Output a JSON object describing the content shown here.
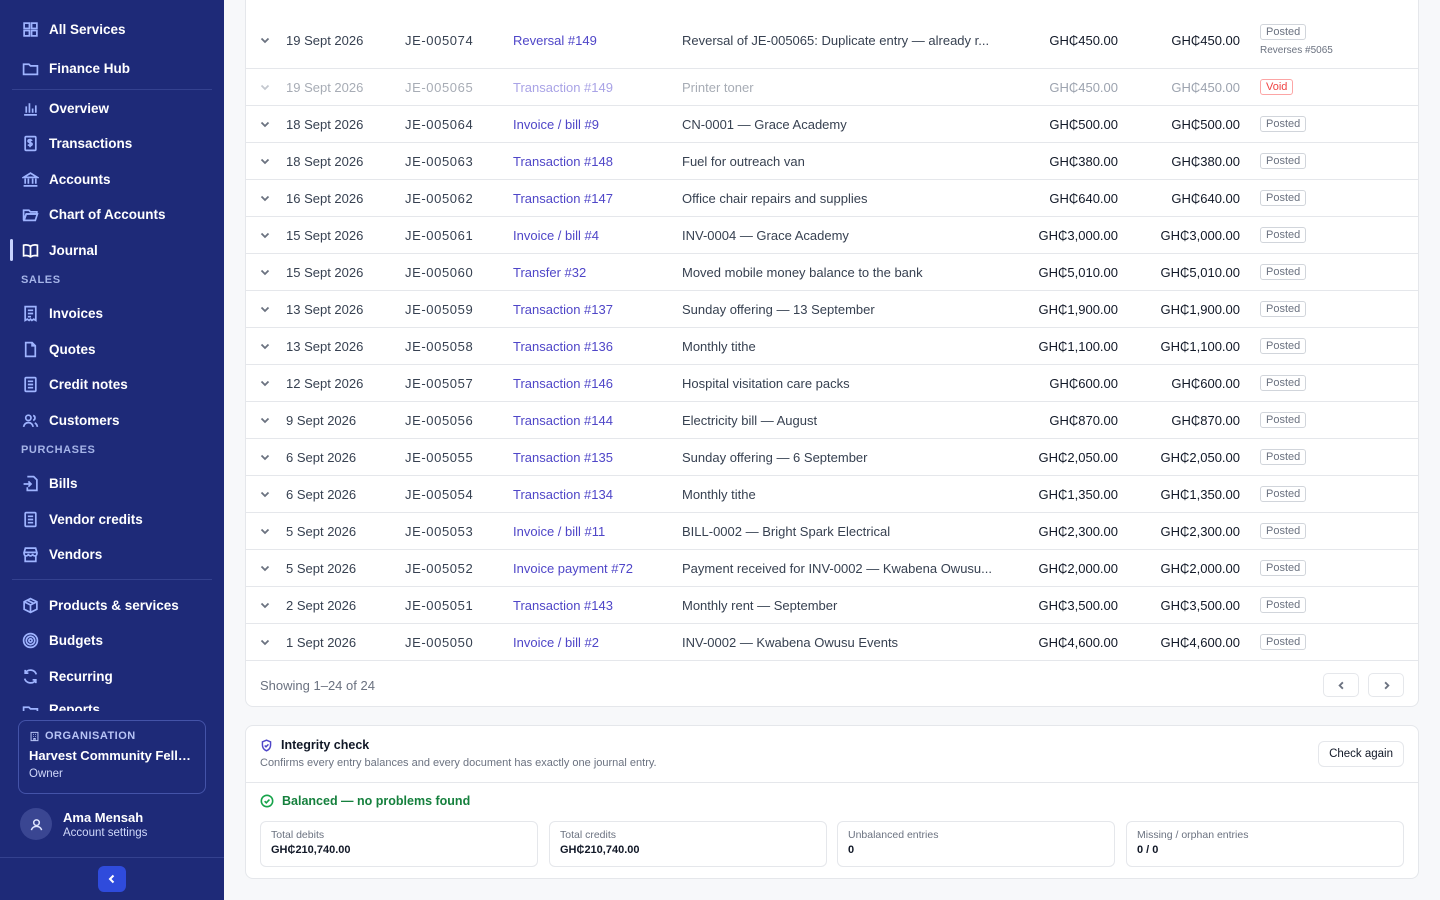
{
  "sidebar": {
    "top_items": [
      {
        "label": "All Services",
        "icon": "grid-icon"
      },
      {
        "label": "Finance Hub",
        "icon": "folder-icon"
      }
    ],
    "main_items": [
      {
        "label": "Overview",
        "icon": "bar-chart-icon"
      },
      {
        "label": "Transactions",
        "icon": "dollar-doc-icon"
      },
      {
        "label": "Accounts",
        "icon": "bank-icon"
      },
      {
        "label": "Chart of Accounts",
        "icon": "folder-open-icon"
      },
      {
        "label": "Journal",
        "icon": "book-open-icon",
        "active": true
      }
    ],
    "sales_label": "SALES",
    "sales_items": [
      {
        "label": "Invoices",
        "icon": "receipt-icon"
      },
      {
        "label": "Quotes",
        "icon": "document-icon"
      },
      {
        "label": "Credit notes",
        "icon": "document-lines-icon"
      },
      {
        "label": "Customers",
        "icon": "users-icon"
      }
    ],
    "purchases_label": "PURCHASES",
    "purchases_items": [
      {
        "label": "Bills",
        "icon": "file-import-icon"
      },
      {
        "label": "Vendor credits",
        "icon": "document-lines-icon"
      },
      {
        "label": "Vendors",
        "icon": "store-icon"
      }
    ],
    "other_items": [
      {
        "label": "Products & services",
        "icon": "package-icon"
      },
      {
        "label": "Budgets",
        "icon": "target-icon"
      },
      {
        "label": "Recurring",
        "icon": "refresh-icon"
      },
      {
        "label": "Reports",
        "icon": "folder-icon"
      }
    ],
    "org": {
      "label": "ORGANISATION",
      "name": "Harvest Community Fello...",
      "role": "Owner"
    },
    "user": {
      "name": "Ama Mensah",
      "sub": "Account settings"
    }
  },
  "journal": {
    "rows": [
      {
        "date": "19 Sept 2026",
        "id": "JE-005074",
        "source": "Reversal #149",
        "description": "Reversal of JE-005065: Duplicate entry — already r...",
        "debit": "GH₵450.00",
        "credit": "GH₵450.00",
        "status": "Posted",
        "note": "Reverses #5065"
      },
      {
        "date": "19 Sept 2026",
        "id": "JE-005065",
        "source": "Transaction #149",
        "description": "Printer toner",
        "debit": "GH₵450.00",
        "credit": "GH₵450.00",
        "status": "Void",
        "muted": true
      },
      {
        "date": "18 Sept 2026",
        "id": "JE-005064",
        "source": "Invoice / bill #9",
        "description": "CN-0001 — Grace Academy",
        "debit": "GH₵500.00",
        "credit": "GH₵500.00",
        "status": "Posted"
      },
      {
        "date": "18 Sept 2026",
        "id": "JE-005063",
        "source": "Transaction #148",
        "description": "Fuel for outreach van",
        "debit": "GH₵380.00",
        "credit": "GH₵380.00",
        "status": "Posted"
      },
      {
        "date": "16 Sept 2026",
        "id": "JE-005062",
        "source": "Transaction #147",
        "description": "Office chair repairs and supplies",
        "debit": "GH₵640.00",
        "credit": "GH₵640.00",
        "status": "Posted"
      },
      {
        "date": "15 Sept 2026",
        "id": "JE-005061",
        "source": "Invoice / bill #4",
        "description": "INV-0004 — Grace Academy",
        "debit": "GH₵3,000.00",
        "credit": "GH₵3,000.00",
        "status": "Posted"
      },
      {
        "date": "15 Sept 2026",
        "id": "JE-005060",
        "source": "Transfer #32",
        "description": "Moved mobile money balance to the bank",
        "debit": "GH₵5,010.00",
        "credit": "GH₵5,010.00",
        "status": "Posted"
      },
      {
        "date": "13 Sept 2026",
        "id": "JE-005059",
        "source": "Transaction #137",
        "description": "Sunday offering — 13 September",
        "debit": "GH₵1,900.00",
        "credit": "GH₵1,900.00",
        "status": "Posted"
      },
      {
        "date": "13 Sept 2026",
        "id": "JE-005058",
        "source": "Transaction #136",
        "description": "Monthly tithe",
        "debit": "GH₵1,100.00",
        "credit": "GH₵1,100.00",
        "status": "Posted"
      },
      {
        "date": "12 Sept 2026",
        "id": "JE-005057",
        "source": "Transaction #146",
        "description": "Hospital visitation care packs",
        "debit": "GH₵600.00",
        "credit": "GH₵600.00",
        "status": "Posted"
      },
      {
        "date": "9 Sept 2026",
        "id": "JE-005056",
        "source": "Transaction #144",
        "description": "Electricity bill — August",
        "debit": "GH₵870.00",
        "credit": "GH₵870.00",
        "status": "Posted"
      },
      {
        "date": "6 Sept 2026",
        "id": "JE-005055",
        "source": "Transaction #135",
        "description": "Sunday offering — 6 September",
        "debit": "GH₵2,050.00",
        "credit": "GH₵2,050.00",
        "status": "Posted"
      },
      {
        "date": "6 Sept 2026",
        "id": "JE-005054",
        "source": "Transaction #134",
        "description": "Monthly tithe",
        "debit": "GH₵1,350.00",
        "credit": "GH₵1,350.00",
        "status": "Posted"
      },
      {
        "date": "5 Sept 2026",
        "id": "JE-005053",
        "source": "Invoice / bill #11",
        "description": "BILL-0002 — Bright Spark Electrical",
        "debit": "GH₵2,300.00",
        "credit": "GH₵2,300.00",
        "status": "Posted"
      },
      {
        "date": "5 Sept 2026",
        "id": "JE-005052",
        "source": "Invoice payment #72",
        "description": "Payment received for INV-0002 — Kwabena Owusu...",
        "debit": "GH₵2,000.00",
        "credit": "GH₵2,000.00",
        "status": "Posted"
      },
      {
        "date": "2 Sept 2026",
        "id": "JE-005051",
        "source": "Transaction #143",
        "description": "Monthly rent — September",
        "debit": "GH₵3,500.00",
        "credit": "GH₵3,500.00",
        "status": "Posted"
      },
      {
        "date": "1 Sept 2026",
        "id": "JE-005050",
        "source": "Invoice / bill #2",
        "description": "INV-0002 — Kwabena Owusu Events",
        "debit": "GH₵4,600.00",
        "credit": "GH₵4,600.00",
        "status": "Posted"
      }
    ],
    "showing": "Showing 1–24 of 24"
  },
  "integrity": {
    "title": "Integrity check",
    "subtitle": "Confirms every entry balances and every document has exactly one journal entry.",
    "check_again": "Check again",
    "result": "Balanced — no problems found",
    "stats": [
      {
        "label": "Total debits",
        "value": "GH₵210,740.00"
      },
      {
        "label": "Total credits",
        "value": "GH₵210,740.00"
      },
      {
        "label": "Unbalanced entries",
        "value": "0"
      },
      {
        "label": "Missing / orphan entries",
        "value": "0 / 0"
      }
    ]
  },
  "colors": {
    "sidebar": "#1e2a78",
    "accent": "#4f46c8",
    "success": "#15803d",
    "danger": "#ef4444"
  }
}
